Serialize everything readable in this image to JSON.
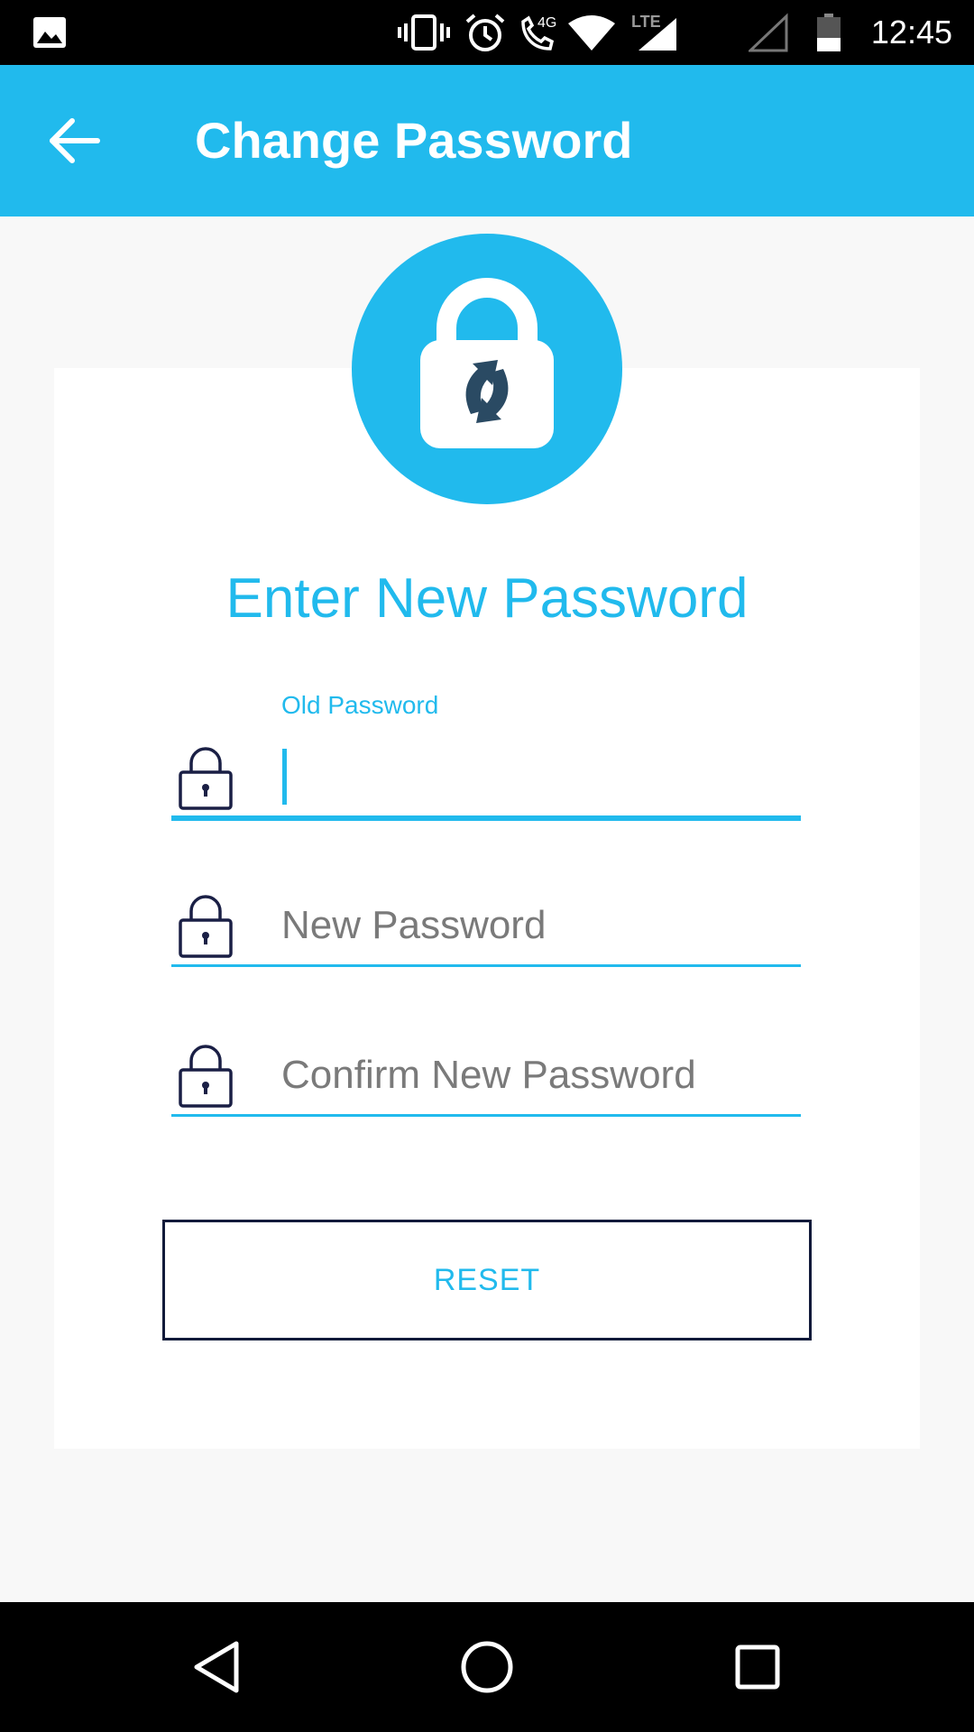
{
  "status_bar": {
    "time": "12:45",
    "network_label": "4G",
    "lte_label": "LTE",
    "icons": [
      "gallery-icon",
      "vibrate-icon",
      "alarm-icon",
      "call-4g-icon",
      "wifi-icon",
      "lte-signal-icon",
      "signal-icon",
      "battery-icon"
    ]
  },
  "app_bar": {
    "title": "Change Password",
    "back_icon": "arrow-left-icon",
    "color": "#21baed"
  },
  "form": {
    "heading": "Enter New Password",
    "fields": [
      {
        "label": "Old Password",
        "value": "",
        "placeholder": "",
        "icon": "lock-icon",
        "focused": true
      },
      {
        "label": "",
        "value": "",
        "placeholder": "New Password",
        "icon": "lock-icon",
        "focused": false
      },
      {
        "label": "",
        "value": "",
        "placeholder": "Confirm New Password",
        "icon": "lock-icon",
        "focused": false
      }
    ],
    "reset_label": "RESET"
  },
  "nav_bar": {
    "icons": [
      "back-triangle-icon",
      "home-circle-icon",
      "recents-square-icon"
    ]
  },
  "colors": {
    "accent": "#21baed",
    "dark": "#111a3a",
    "background": "#f8f8f8"
  }
}
